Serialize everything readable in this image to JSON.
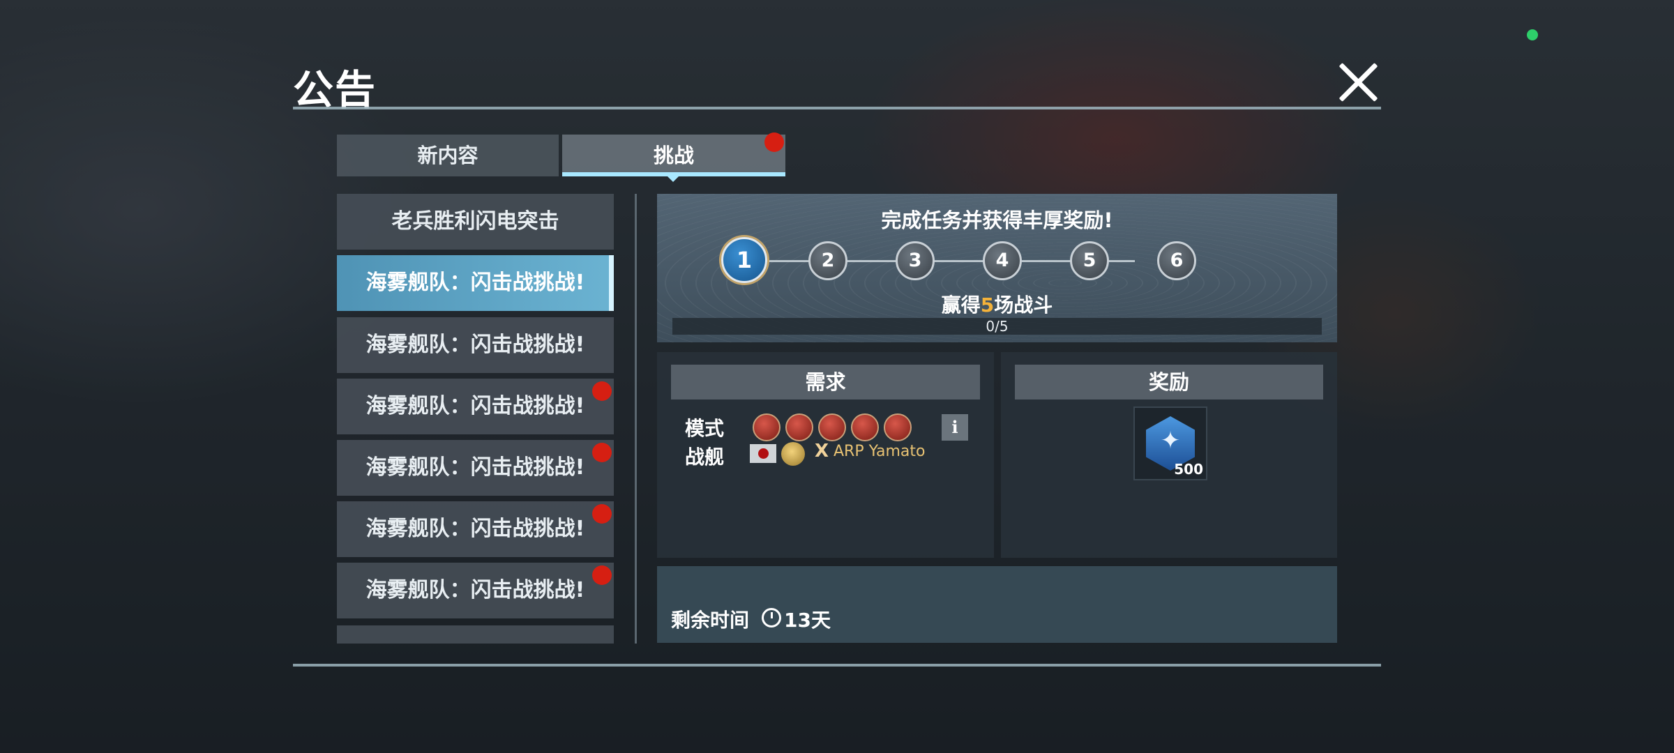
{
  "dialog": {
    "title": "公告"
  },
  "tabs": [
    {
      "label": "新内容"
    },
    {
      "label": "挑战",
      "active": true,
      "has_badge": true
    }
  ],
  "list": {
    "items": [
      {
        "label": "老兵胜利闪电突击",
        "active": false,
        "badge": false
      },
      {
        "label": "海雾舰队：闪击战挑战!",
        "active": true,
        "badge": false
      },
      {
        "label": "海雾舰队：闪击战挑战!",
        "active": false,
        "badge": false
      },
      {
        "label": "海雾舰队：闪击战挑战!",
        "active": false,
        "badge": true
      },
      {
        "label": "海雾舰队：闪击战挑战!",
        "active": false,
        "badge": true
      },
      {
        "label": "海雾舰队：闪击战挑战!",
        "active": false,
        "badge": true
      },
      {
        "label": "海雾舰队：闪击战挑战!",
        "active": false,
        "badge": true
      }
    ]
  },
  "banner": {
    "title": "完成任务并获得丰厚奖励!",
    "steps": [
      "1",
      "2",
      "3",
      "4",
      "5",
      "6"
    ],
    "active_step": 1,
    "task_prefix": "赢得",
    "task_count": "5",
    "task_suffix": "场战斗",
    "progress_text": "0/5",
    "progress_fraction": 0.0
  },
  "requirements": {
    "header": "需求",
    "mode_label": "模式",
    "ship_label": "战舰",
    "mode_icons": [
      "mode-icon-1",
      "mode-icon-2",
      "mode-icon-3",
      "mode-icon-4",
      "mode-icon-5"
    ],
    "info_label": "i",
    "times_label": "X",
    "ship_name": "ARP Yamato"
  },
  "rewards": {
    "header": "奖励",
    "item_icon": "phoenix-emblem-icon",
    "quantity": "500"
  },
  "footer": {
    "remaining_label": "剩余时间",
    "days": "13天"
  },
  "colors": {
    "accent": "#79c7ea",
    "badge": "#d61f12",
    "highlight_number": "#f4b23a",
    "status_dot": "#2ecf6a"
  }
}
